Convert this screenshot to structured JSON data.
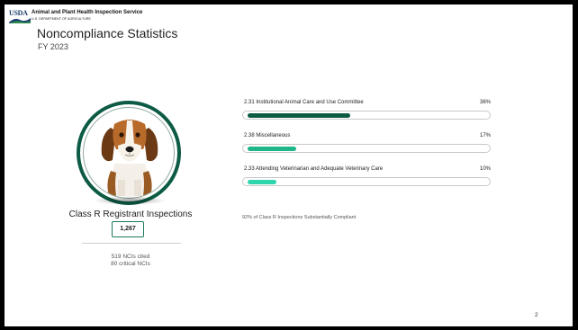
{
  "header": {
    "logo_text": "USDA",
    "agency": "Animal and Plant Health Inspection Service",
    "department": "U.S. DEPARTMENT OF AGRICULTURE"
  },
  "title": "Noncompliance Statistics",
  "subtitle": "FY 2023",
  "left_panel": {
    "image": "beagle-dog-photo",
    "label": "Class R Registrant Inspections",
    "count": "1,267",
    "ncis_cited": "519 NCIs cited",
    "critical_ncis": "80 critical NCIs"
  },
  "stats": [
    {
      "label": "2.31 Institutional Animal Care and Use Committee",
      "percent_label": "36%",
      "percent": 36,
      "color": "#0d5b45"
    },
    {
      "label": "2.38 Miscellaneous",
      "percent_label": "17%",
      "percent": 17,
      "color": "#1fb68a"
    },
    {
      "label": "2.33 Attending Veterinarian and Adequate Veterinary Care",
      "percent_label": "10%",
      "percent": 10,
      "color": "#2fd6ad"
    }
  ],
  "compliance_note": "92% of Class R Inspections Substantially Compliant",
  "page_number": "2"
}
